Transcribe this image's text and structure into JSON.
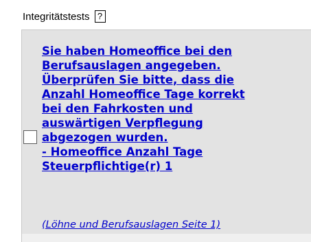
{
  "panel": {
    "title": "Integritätstests",
    "help_icon_glyph": "?"
  },
  "issues": [
    {
      "lines": [
        "Sie haben Homeoffice bei den",
        "Berufsauslagen angegeben.",
        "Überprüfen Sie bitte, dass die",
        "Anzahl Homeoffice Tage korrekt",
        "bei den Fahrkosten und",
        "auswärtigen Verpflegung",
        "abgezogen wurden.",
        "- Homeoffice Anzahl Tage",
        "Steuerpflichtige(r) 1"
      ],
      "reference": "(Löhne und Berufsauslagen Seite 1)",
      "checked": false
    }
  ],
  "colors": {
    "link": "#0000cc",
    "row_background": "#e3e3e3",
    "panel_background": "#f0f0f0"
  }
}
